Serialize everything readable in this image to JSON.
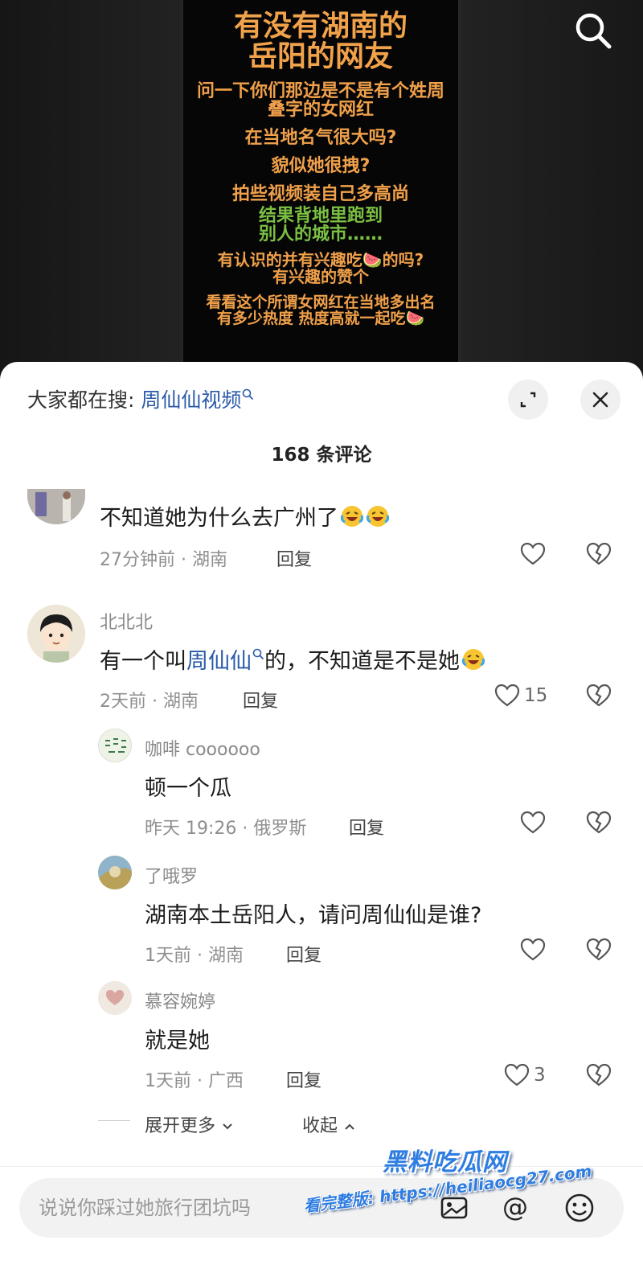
{
  "video": {
    "poster_lines": [
      {
        "text": "有没有湖南的",
        "style": "title"
      },
      {
        "text": "岳阳的网友",
        "style": "title"
      },
      {
        "text": "问一下你们那边是不是有个姓周",
        "style": "orange"
      },
      {
        "text": "叠字的女网红",
        "style": "orange"
      },
      {
        "text": "在当地名气很大吗?",
        "style": "orange"
      },
      {
        "text": "貌似她很拽?",
        "style": "orange"
      },
      {
        "text": "拍些视频装自己多高尚",
        "style": "orange"
      },
      {
        "text": "结果背地里跑到",
        "style": "green"
      },
      {
        "text": "别人的城市……",
        "style": "green"
      },
      {
        "text": "有认识的并有兴趣吃🍉的吗?",
        "style": "orange"
      },
      {
        "text": "有兴趣的赞个",
        "style": "orange"
      },
      {
        "text": "看看这个所谓女网红在当地多出名",
        "style": "orange"
      },
      {
        "text": "有多少热度 热度高就一起吃🍉",
        "style": "orange"
      }
    ]
  },
  "sheet": {
    "trending_label": "大家都在搜:",
    "trending_link": "周仙仙视频",
    "comment_count": "168 条评论"
  },
  "comments": {
    "c0": {
      "text": "不知道她为什么去广州了",
      "time": "27分钟前 · 湖南",
      "reply": "回复"
    },
    "c1": {
      "name": "北北北",
      "text_a": "有一个叫",
      "text_link": "周仙仙",
      "text_b": "的，不知道是不是她",
      "time": "2天前 · 湖南",
      "reply": "回复",
      "likes": "15"
    },
    "r1": {
      "name": "咖啡 coooooo",
      "text": "顿一个瓜",
      "time": "昨天 19:26 · 俄罗斯",
      "reply": "回复"
    },
    "r2": {
      "name": "了哦罗",
      "text": "湖南本土岳阳人，请问周仙仙是谁?",
      "time": "1天前 · 湖南",
      "reply": "回复"
    },
    "r3": {
      "name": "慕容婉婷",
      "text": "就是她",
      "time": "1天前 · 广西",
      "reply": "回复",
      "likes": "3"
    }
  },
  "thread_controls": {
    "expand_more": "展开更多",
    "collapse": "收起"
  },
  "input": {
    "placeholder": "说说你踩过她旅行团坑吗"
  },
  "watermark": {
    "line1": "黑料吃瓜网",
    "line2": "看完整版: https://heiliaocg27.com"
  },
  "colors": {
    "link": "#2a5aa8",
    "poster_orange": "#f0a04a",
    "poster_green": "#7bc043"
  }
}
